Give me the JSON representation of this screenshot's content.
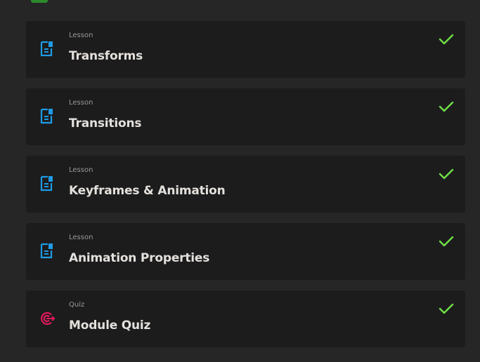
{
  "colors": {
    "background": "#262626",
    "card": "#1c1c1d",
    "lesson_icon": "#1e9be6",
    "quiz_icon": "#e0195a",
    "check": "#6fe046",
    "completed_indicator": "#2b8a2b"
  },
  "items": [
    {
      "type": "Lesson",
      "title": "Transforms",
      "icon": "document-icon",
      "completed": true
    },
    {
      "type": "Lesson",
      "title": "Transitions",
      "icon": "document-icon",
      "completed": true
    },
    {
      "type": "Lesson",
      "title": "Keyframes & Animation",
      "icon": "document-icon",
      "completed": true
    },
    {
      "type": "Lesson",
      "title": "Animation Properties",
      "icon": "document-icon",
      "completed": true
    },
    {
      "type": "Quiz",
      "title": "Module Quiz",
      "icon": "target-icon",
      "completed": true
    }
  ]
}
